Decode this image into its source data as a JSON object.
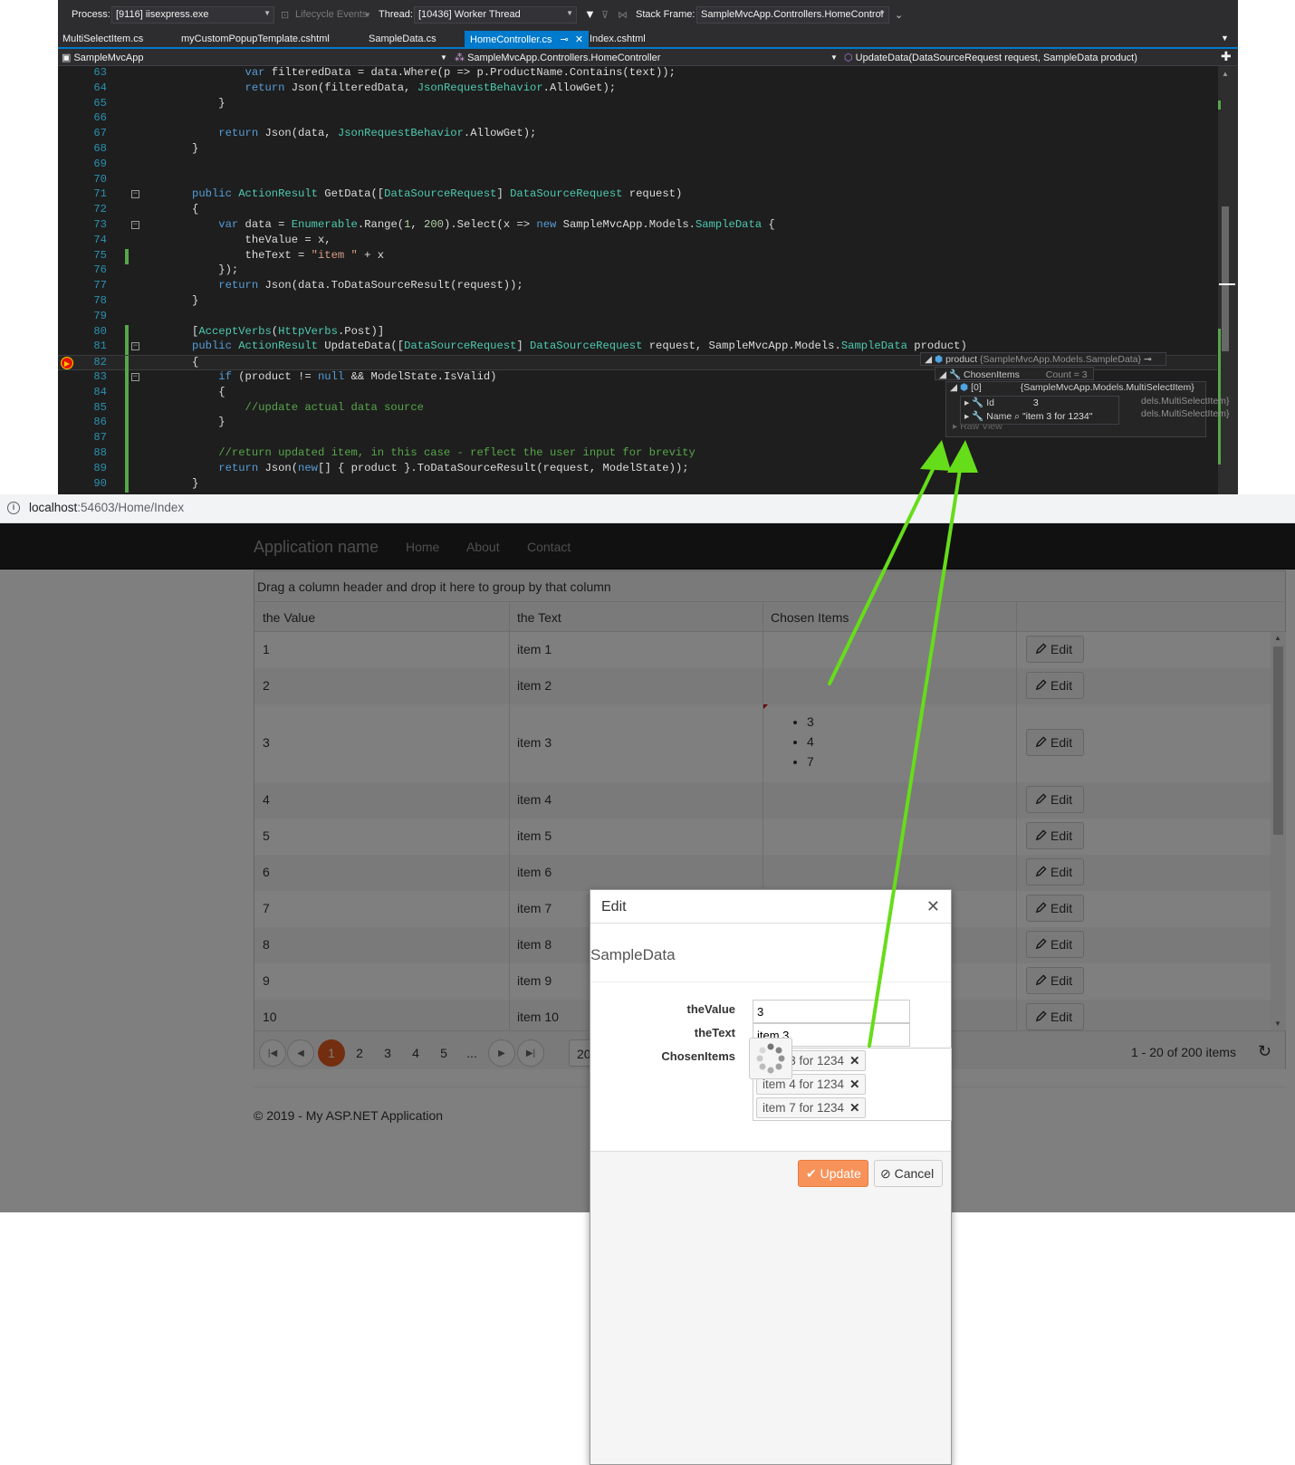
{
  "vs": {
    "toolbar": {
      "process_label": "Process:",
      "process_value": "[9116] iisexpress.exe",
      "lifecycle": "Lifecycle Events",
      "thread_label": "Thread:",
      "thread_value": "[10436] Worker Thread",
      "stack_label": "Stack Frame:",
      "stack_value": "SampleMvcApp.Controllers.HomeControl"
    },
    "tabs": [
      {
        "label": "MultiSelectItem.cs"
      },
      {
        "label": "myCustomPopupTemplate.cshtml"
      },
      {
        "label": "SampleData.cs"
      },
      {
        "label": "HomeController.cs"
      },
      {
        "label": "Index.cshtml"
      }
    ],
    "nav": {
      "project": "SampleMvcApp",
      "class": "SampleMvcApp.Controllers.HomeController",
      "method": "UpdateData(DataSourceRequest request, SampleData product)"
    },
    "code_lines": [
      {
        "num": "63",
        "text": "        var filteredData = data.Where(p => p.ProductName.Contains(text));"
      },
      {
        "num": "64",
        "text": "        return Json(filteredData, JsonRequestBehavior.AllowGet);"
      },
      {
        "num": "65",
        "text": "    }"
      },
      {
        "num": "66",
        "text": ""
      },
      {
        "num": "67",
        "text": "    return Json(data, JsonRequestBehavior.AllowGet);"
      },
      {
        "num": "68",
        "text": "}"
      },
      {
        "num": "69",
        "text": ""
      },
      {
        "num": "70",
        "text": ""
      },
      {
        "num": "71",
        "text": "public ActionResult GetData([DataSourceRequest] DataSourceRequest request)"
      },
      {
        "num": "72",
        "text": "{"
      },
      {
        "num": "73",
        "text": "    var data = Enumerable.Range(1, 200).Select(x => new SampleMvcApp.Models.SampleData {"
      },
      {
        "num": "74",
        "text": "        theValue = x,"
      },
      {
        "num": "75",
        "text": "        theText = \"item \" + x"
      },
      {
        "num": "76",
        "text": "    });"
      },
      {
        "num": "77",
        "text": "    return Json(data.ToDataSourceResult(request));"
      },
      {
        "num": "78",
        "text": "}"
      },
      {
        "num": "79",
        "text": ""
      },
      {
        "num": "80",
        "text": "[AcceptVerbs(HttpVerbs.Post)]"
      },
      {
        "num": "81",
        "text": "public ActionResult UpdateData([DataSourceRequest] DataSourceRequest request, SampleMvcApp.Models.SampleData product)"
      },
      {
        "num": "82",
        "text": "{"
      },
      {
        "num": "83",
        "text": "    if (product != null && ModelState.IsValid)"
      },
      {
        "num": "84",
        "text": "    {"
      },
      {
        "num": "85",
        "text": "        //update actual data source"
      },
      {
        "num": "86",
        "text": "    }"
      },
      {
        "num": "87",
        "text": ""
      },
      {
        "num": "88",
        "text": "    //return updated item, in this case - reflect the user input for brevity"
      },
      {
        "num": "89",
        "text": "    return Json(new[] { product }.ToDataSourceResult(request, ModelState));"
      },
      {
        "num": "90",
        "text": "}"
      }
    ],
    "datatip": {
      "product_name": "product",
      "product_value": "{SampleMvcApp.Models.SampleData}",
      "chosen_name": "ChosenItems",
      "chosen_value": "Count = 3",
      "item0_name": "[0]",
      "item0_value": "{SampleMvcApp.Models.MultiSelectItem}",
      "id_name": "Id",
      "id_value": "3",
      "name_name": "Name",
      "name_value": "\"item 3 for 1234\"",
      "item1_value": "dels.MultiSelectItem}",
      "item2_value": "dels.MultiSelectItem}",
      "raw_view": "Raw View"
    }
  },
  "browser": {
    "url_host": "localhost",
    "url_rest": ":54603/Home/Index"
  },
  "app": {
    "brand": "Application name",
    "nav": [
      "Home",
      "About",
      "Contact"
    ],
    "group_hint": "Drag a column header and drop it here to group by that column",
    "columns": [
      "the Value",
      "the Text",
      "Chosen Items"
    ],
    "edit_label": "Edit",
    "rows": [
      {
        "value": "1",
        "text": "item 1"
      },
      {
        "value": "2",
        "text": "item 2"
      },
      {
        "value": "3",
        "text": "item 3",
        "chosen": [
          "3",
          "4",
          "7"
        ]
      },
      {
        "value": "4",
        "text": "item 4"
      },
      {
        "value": "5",
        "text": "item 5"
      },
      {
        "value": "6",
        "text": "item 6"
      },
      {
        "value": "7",
        "text": "item 7"
      },
      {
        "value": "8",
        "text": "item 8"
      },
      {
        "value": "9",
        "text": "item 9"
      },
      {
        "value": "10",
        "text": "item 10"
      }
    ],
    "pager": {
      "pages": [
        "1",
        "2",
        "3",
        "4",
        "5",
        "..."
      ],
      "page_size_partial": "20",
      "info": "1 - 20 of 200 items"
    },
    "footer": "© 2019 - My ASP.NET Application"
  },
  "modal": {
    "title": "Edit",
    "subtitle": "SampleData",
    "fields": {
      "value_label": "theValue",
      "value": "3",
      "text_label": "theText",
      "text": "item 3",
      "chosen_label": "ChosenItems"
    },
    "chosen_tags": [
      "item 3 for 1234",
      "item 4 for 1234",
      "item 7 for 1234"
    ],
    "tag_partial_1": "3 for 1234",
    "tag_partial_2": "item 4 for 1234",
    "update_label": "Update",
    "cancel_label": "Cancel"
  },
  "colors": {
    "accent": "#007acc",
    "arrow": "#66dd1a",
    "pager_current": "#e65c1e",
    "update_button": "#f7935a"
  }
}
